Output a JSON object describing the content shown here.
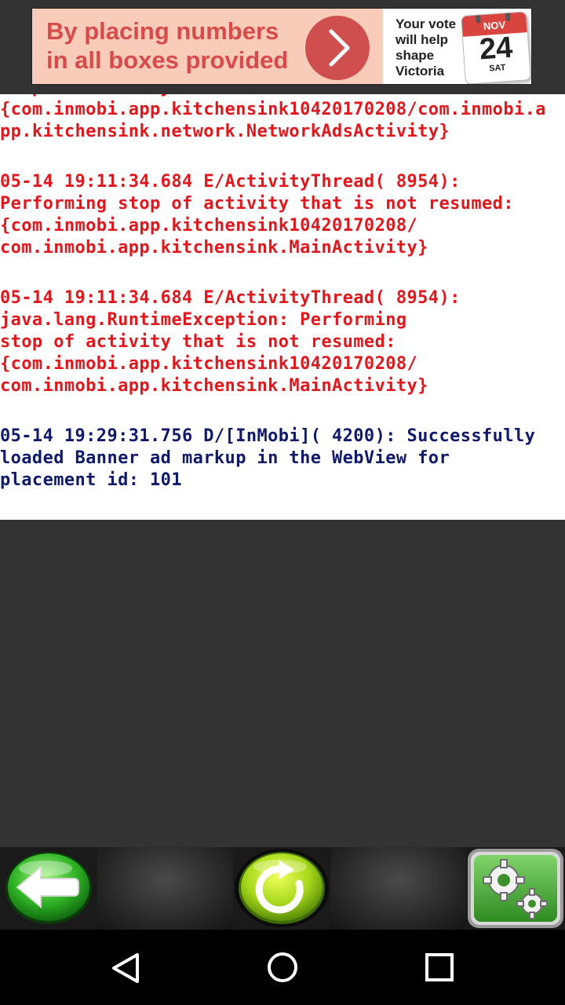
{
  "ad": {
    "headline_line1": "By placing numbers",
    "headline_line2": "in all boxes provided",
    "tagline_line1": "Your vote",
    "tagline_line2": "will help",
    "tagline_line3": "shape",
    "tagline_line4": "Victoria",
    "calendar_month": "NOV",
    "calendar_day": "24",
    "calendar_weekday": "SAT",
    "arrow_icon": "chevron-right-icon",
    "colors": {
      "background": "#f8ccb8",
      "headline": "#d94a4a",
      "arrow": "#cf4f4f"
    }
  },
  "log": {
    "entries": [
      {
        "level": "error",
        "lines": [
          "stop of activity that is not resumed:",
          "{com.inmobi.app.kitchensink10420170208/com.inmobi.a",
          "pp.kitchensink.network.NetworkAdsActivity}"
        ]
      },
      {
        "level": "error",
        "lines": [
          "05-14 19:11:34.684 E/ActivityThread( 8954):",
          "Performing stop of activity that is not resumed:",
          "{com.inmobi.app.kitchensink10420170208/",
          "com.inmobi.app.kitchensink.MainActivity}"
        ]
      },
      {
        "level": "error",
        "lines": [
          "05-14 19:11:34.684 E/ActivityThread( 8954):",
          "java.lang.RuntimeException: Performing",
          "stop of activity that is not resumed:",
          "{com.inmobi.app.kitchensink10420170208/",
          "com.inmobi.app.kitchensink.MainActivity}"
        ]
      },
      {
        "level": "debug",
        "lines": [
          "05-14 19:29:31.756 D/[InMobi]( 4200): Successfully",
          "loaded Banner ad markup in the WebView for",
          "placement id: 101"
        ]
      }
    ],
    "colors": {
      "error": "#e3161c",
      "debug": "#0f1a6b"
    }
  },
  "toolbar": {
    "back_icon": "back-arrow-icon",
    "refresh_icon": "refresh-icon",
    "settings_icon": "gears-icon"
  },
  "navbar": {
    "back_icon": "triangle-back-icon",
    "home_icon": "circle-home-icon",
    "recents_icon": "square-recents-icon"
  }
}
